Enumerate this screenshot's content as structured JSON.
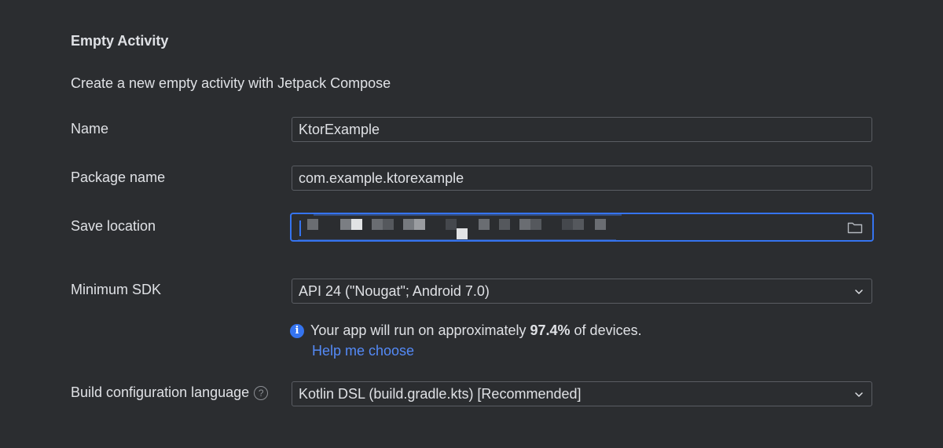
{
  "header": {
    "title": "Empty Activity",
    "description": "Create a new empty activity with Jetpack Compose"
  },
  "form": {
    "name": {
      "label": "Name",
      "value": "KtorExample"
    },
    "package_name": {
      "label": "Package name",
      "value": "com.example.ktorexample"
    },
    "save_location": {
      "label": "Save location",
      "value": "",
      "browse_icon": "folder-icon"
    },
    "minimum_sdk": {
      "label": "Minimum SDK",
      "selected": "API 24 (\"Nougat\"; Android 7.0)"
    },
    "sdk_info": {
      "prefix": "Your app will run on approximately ",
      "percentage": "97.4%",
      "suffix": " of devices.",
      "help_link": "Help me choose"
    },
    "build_language": {
      "label": "Build configuration language",
      "selected": "Kotlin DSL (build.gradle.kts) [Recommended]"
    }
  },
  "colors": {
    "background": "#2b2d30",
    "border": "#5a5d63",
    "focus": "#3574f0",
    "link": "#548af7",
    "text": "#dfe1e5"
  }
}
